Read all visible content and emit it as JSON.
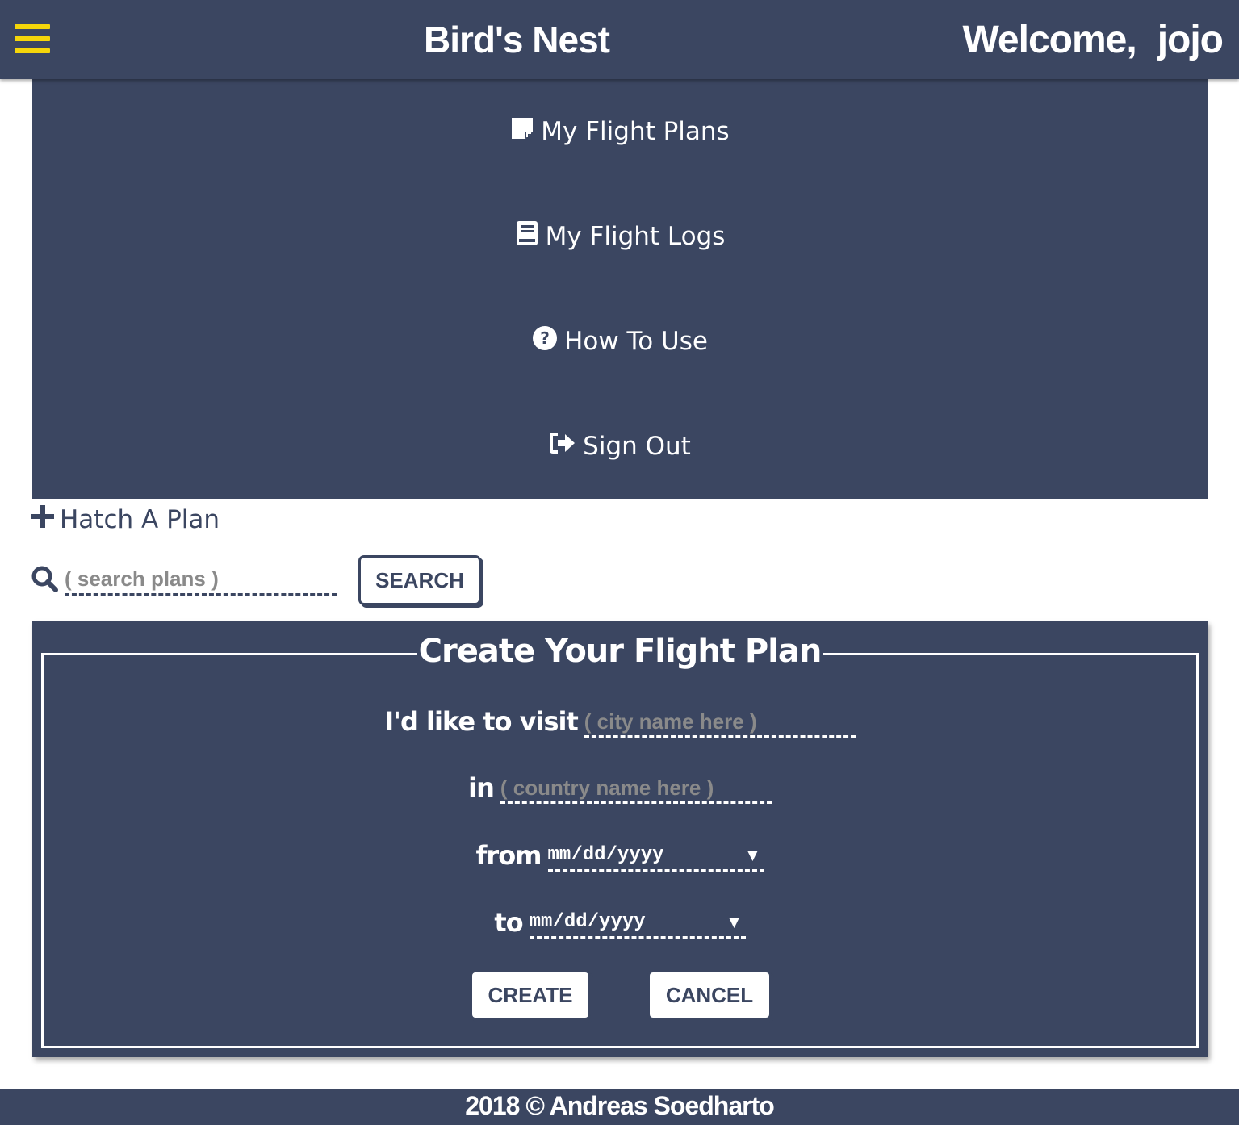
{
  "header": {
    "menu_icon": "hamburger-menu-icon",
    "brand": "Bird's Nest",
    "welcome": "Welcome,",
    "username": "jojo"
  },
  "menu": {
    "items": [
      {
        "label": "My Flight Plans",
        "icon": "note-icon"
      },
      {
        "label": "My Flight Logs",
        "icon": "book-icon"
      },
      {
        "label": "How To Use",
        "icon": "question-circle-icon"
      },
      {
        "label": "Sign Out",
        "icon": "sign-out-icon"
      }
    ]
  },
  "hatch": {
    "label": "Hatch A Plan",
    "icon": "plus-icon"
  },
  "search": {
    "placeholder": "( search plans )",
    "button_label": "SEARCH",
    "icon": "search-icon"
  },
  "form": {
    "title": "Create Your Flight Plan",
    "visit_label": "I'd like to visit",
    "city_placeholder": "( city name here )",
    "in_label": "in",
    "country_placeholder": "( country name here )",
    "from_label": "from",
    "from_value": "mm/dd/yyyy",
    "to_label": "to",
    "to_value": "mm/dd/yyyy",
    "dropdown_glyph": "▼",
    "create_label": "CREATE",
    "cancel_label": "CANCEL"
  },
  "footer": {
    "text": "2018 © Andreas Soedharto"
  },
  "colors": {
    "primary": "#3b4661",
    "accent": "#f5d60a",
    "text": "#ffffff"
  }
}
